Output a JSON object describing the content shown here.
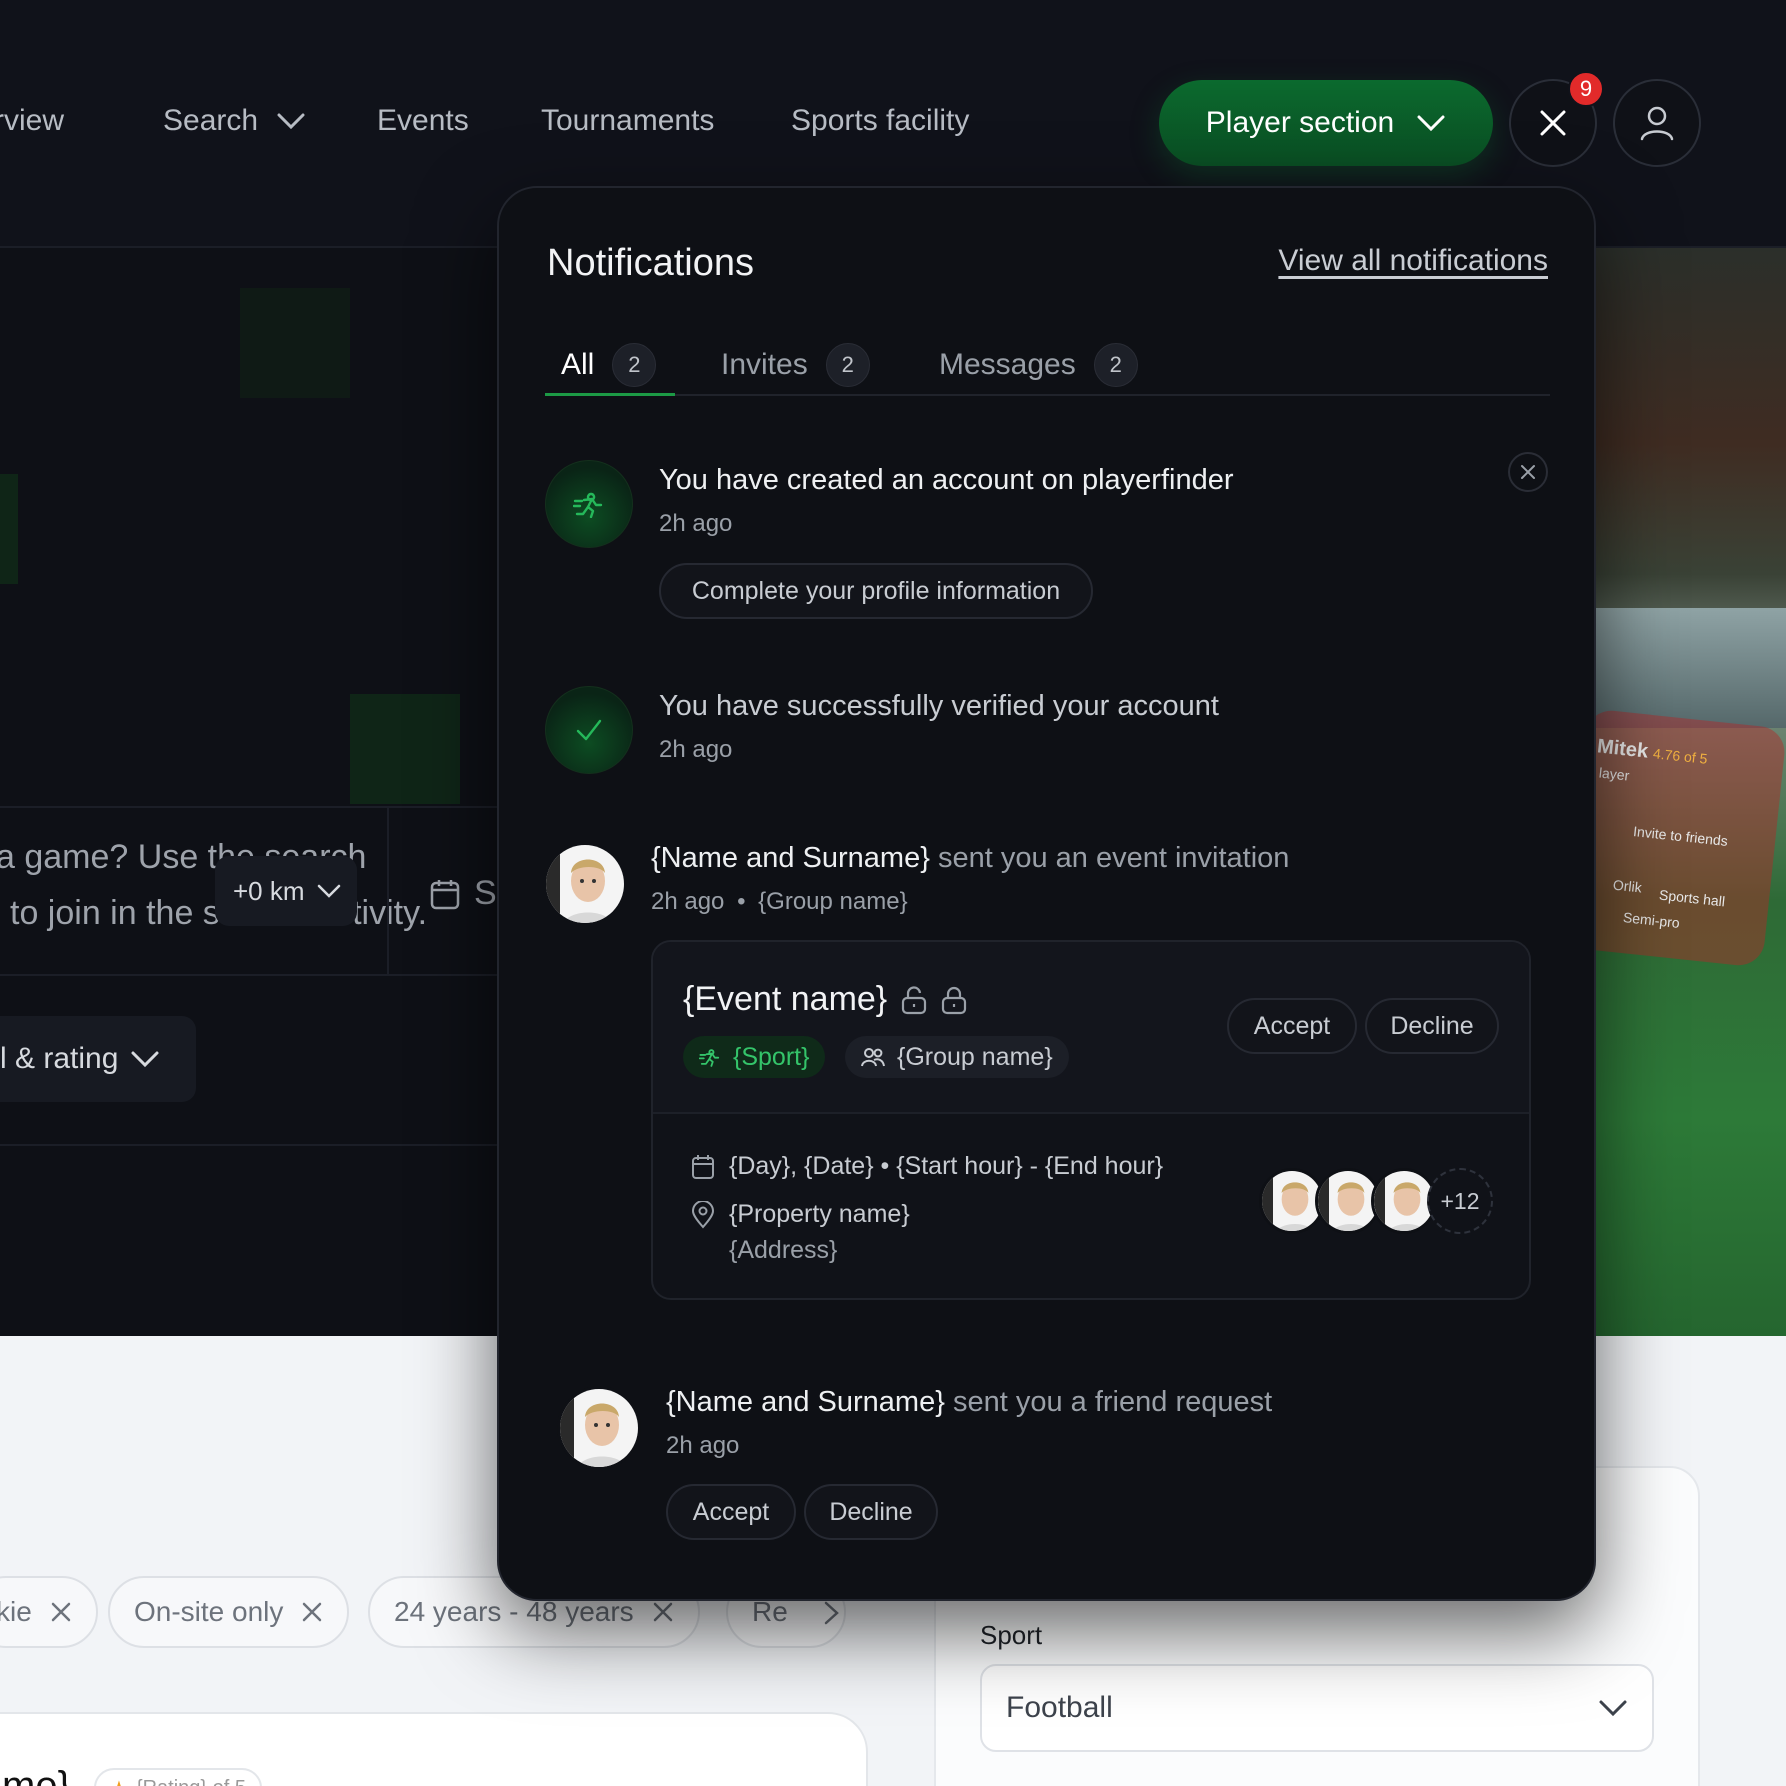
{
  "nav": {
    "items": [
      "rview",
      "Search",
      "Events",
      "Tournaments",
      "Sports facility"
    ],
    "player_section": "Player section",
    "notification_count": "9"
  },
  "hero": {
    "text_line1": "a game? Use the search",
    "text_line2": "to join in the shared activity.",
    "distance": "+0 km",
    "date_partial": "S",
    "level_rating": "l & rating"
  },
  "photo_overlay": {
    "name": "Mitek",
    "role": "layer",
    "rating": "4.76 of 5",
    "invite": "Invite to friends",
    "tag1": "Orlik",
    "tag2": "Sports hall",
    "tag3": "Semi-pro"
  },
  "notifications": {
    "title": "Notifications",
    "view_all": "View all notifications",
    "tabs": [
      {
        "label": "All",
        "count": "2"
      },
      {
        "label": "Invites",
        "count": "2"
      },
      {
        "label": "Messages",
        "count": "2"
      }
    ],
    "items": {
      "created": {
        "text": "You have created an account on playerfinder",
        "time": "2h ago",
        "action": "Complete your profile information"
      },
      "verified": {
        "text": "You have successfully verified your account",
        "time": "2h ago"
      },
      "invitation": {
        "name": "{Name and Surname}",
        "text": "sent you an event invitation",
        "time": "2h ago",
        "sep": "•",
        "group": "{Group name}",
        "event": {
          "name": "{Event name}",
          "sport": "{Sport}",
          "group": "{Group name}",
          "accept": "Accept",
          "decline": "Decline",
          "datetime": "{Day}, {Date} • {Start hour} - {End hour}",
          "property": "{Property name}",
          "address": "{Address}",
          "more_participants": "+12"
        }
      },
      "friend": {
        "name": "{Name and Surname}",
        "text": "sent you a friend request",
        "time": "2h ago",
        "accept": "Accept",
        "decline": "Decline"
      }
    }
  },
  "filters": {
    "chips": [
      "kie",
      "On-site only",
      "24 years - 48 years",
      "Re"
    ]
  },
  "sidebar": {
    "sport_label": "Sport",
    "sport_value": "Football"
  },
  "card": {
    "title_partial": "me}",
    "rating": "{Rating} of 5"
  },
  "colors": {
    "accent_green": "#1c9a45",
    "badge_red": "#e22a2a",
    "panel_bg": "#0e1015"
  }
}
